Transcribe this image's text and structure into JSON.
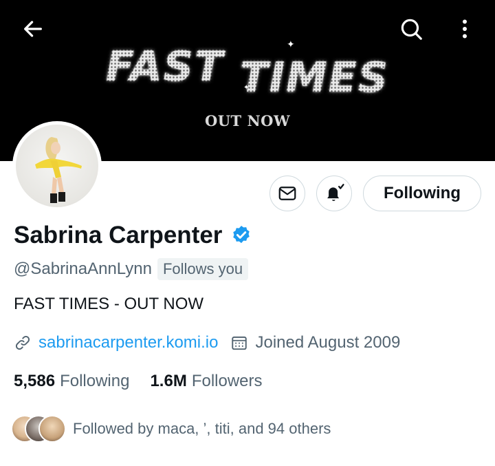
{
  "banner": {
    "title_part1": "FAST",
    "title_part2": "TIMES",
    "subtitle": "OUT NOW"
  },
  "nav": {
    "back_icon": "arrow-left-icon",
    "search_icon": "search-icon",
    "more_icon": "more-vertical-icon"
  },
  "profile": {
    "display_name": "Sabrina Carpenter",
    "verified": true,
    "handle": "@SabrinaAnnLynn",
    "follows_you": "Follows you",
    "bio": "FAST TIMES - OUT NOW",
    "link": "sabrinacarpenter.komi.io",
    "joined": "Joined August 2009"
  },
  "actions": {
    "message_icon": "envelope-icon",
    "notify_icon": "bell-check-icon",
    "follow_label": "Following"
  },
  "stats": {
    "following_count": "5,586",
    "following_label": "Following",
    "followers_count": "1.6M",
    "followers_label": "Followers"
  },
  "followed_by": {
    "text": "Followed by maca, ’, titi, and 94 others"
  },
  "colors": {
    "accent": "#1d9bf0",
    "secondary_text": "#536471",
    "primary_text": "#0f1419",
    "border": "#cfd9de"
  }
}
